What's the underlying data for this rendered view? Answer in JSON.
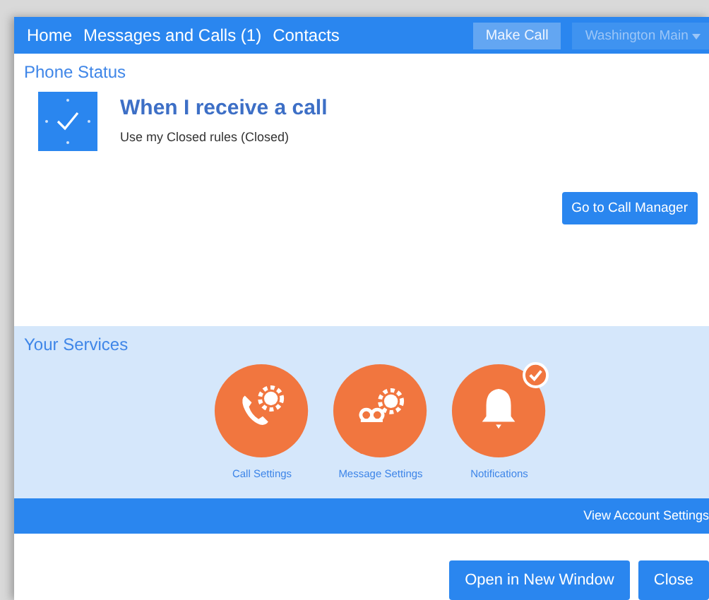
{
  "nav": {
    "links": [
      {
        "label": "Home"
      },
      {
        "label": "Messages and Calls (1)"
      },
      {
        "label": "Contacts"
      }
    ],
    "make_call": {
      "label": "Make Call"
    },
    "location": {
      "label": "Washington Main",
      "disabled": true
    }
  },
  "phone_status": {
    "title": "Phone Status",
    "heading": "When I receive a call",
    "detail": "Use my Closed rules (Closed)",
    "button": "Go to Call Manager"
  },
  "services": {
    "title": "Your Services",
    "items": [
      {
        "kind": "call",
        "label": "Call Settings",
        "checked": false
      },
      {
        "kind": "message",
        "label": "Message Settings",
        "checked": false
      },
      {
        "kind": "notify",
        "label": "Notifications",
        "checked": true
      }
    ]
  },
  "account_bar": {
    "link": "View Account Settings"
  },
  "buttons": [
    {
      "label": "Open in New Window"
    },
    {
      "label": "Close"
    }
  ]
}
